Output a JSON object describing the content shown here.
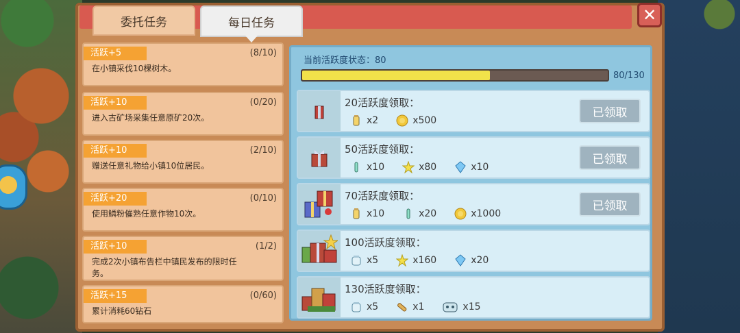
{
  "tabs": [
    {
      "label": "委托任务"
    },
    {
      "label": "每日任务"
    }
  ],
  "close_label": "✕",
  "tasks": [
    {
      "tag": "活跃+5",
      "progress": "(8/10)",
      "desc": "在小镇采伐10棵树木。"
    },
    {
      "tag": "活跃+10",
      "progress": "(0/20)",
      "desc": "进入古矿场采集任意原矿20次。"
    },
    {
      "tag": "活跃+10",
      "progress": "(2/10)",
      "desc": "赠送任意礼物给小镇10位居民。"
    },
    {
      "tag": "活跃+20",
      "progress": "(0/10)",
      "desc": "使用鳞粉催熟任意作物10次。"
    },
    {
      "tag": "活跃+10",
      "progress": "(1/2)",
      "desc": "完成2次小镇布告栏中镇民发布的限时任务。"
    },
    {
      "tag": "活跃+15",
      "progress": "(0/60)",
      "desc": "累计消耗60钻石"
    }
  ],
  "activity": {
    "label": "当前活跃度状态：80",
    "progress_text": "80/130",
    "progress_fraction": 0.615
  },
  "rewards": [
    {
      "title": "20活跃度领取：",
      "button": "已领取",
      "items": [
        {
          "icon": "bottle-icon",
          "qty": "x2"
        },
        {
          "icon": "coin-icon",
          "qty": "x500"
        }
      ]
    },
    {
      "title": "50活跃度领取：",
      "button": "已领取",
      "items": [
        {
          "icon": "potion-icon",
          "qty": "x10"
        },
        {
          "icon": "star-icon",
          "qty": "x80"
        },
        {
          "icon": "diamond-icon",
          "qty": "x10"
        }
      ]
    },
    {
      "title": "70活跃度领取：",
      "button": "已领取",
      "items": [
        {
          "icon": "bottle-icon",
          "qty": "x10"
        },
        {
          "icon": "potion-icon",
          "qty": "x20"
        },
        {
          "icon": "coin-icon",
          "qty": "x1000"
        }
      ]
    },
    {
      "title": "100活跃度领取：",
      "button": "",
      "items": [
        {
          "icon": "jar-icon",
          "qty": "x5"
        },
        {
          "icon": "star-icon",
          "qty": "x160"
        },
        {
          "icon": "diamond-icon",
          "qty": "x20"
        }
      ]
    },
    {
      "title": "130活跃度领取：",
      "button": "",
      "items": [
        {
          "icon": "jar-icon",
          "qty": "x5"
        },
        {
          "icon": "wood-icon",
          "qty": "x1"
        },
        {
          "icon": "robot-icon",
          "qty": "x15"
        }
      ]
    }
  ]
}
